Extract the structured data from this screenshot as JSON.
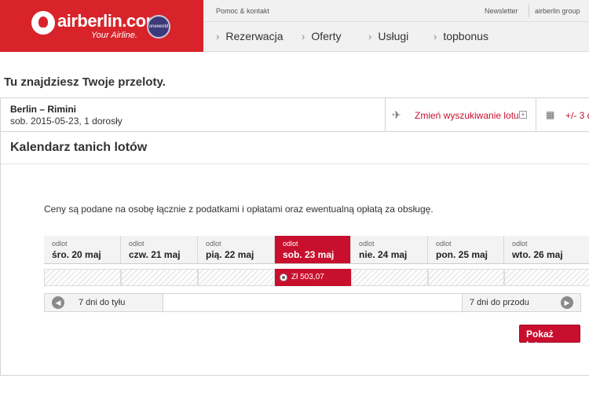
{
  "header": {
    "logo_text": "airberlin.com",
    "logo_tagline": "Your Airline.",
    "alliance_badge": "oneworld",
    "help_link": "Pomoc & kontakt",
    "newsletter_link": "Newsletter",
    "group_link": "airberlin group",
    "nav": [
      "Rezerwacja",
      "Oferty",
      "Usługi",
      "topbonus"
    ]
  },
  "page": {
    "title": "Tu znajdziesz Twoje przeloty."
  },
  "summary": {
    "route": "Berlin – Rimini",
    "details": "sob. 2015-05-23, 1 dorosły",
    "change_search": "Zmień wyszukiwanie lotu",
    "flex_days": "+/- 3 d"
  },
  "calendar": {
    "title": "Kalendarz tanich lotów",
    "info": "Ceny są podane na osobę łącznie z podatkami i opłatami oraz ewentualną opłatą za obsługę.",
    "days": [
      {
        "label": "odlot",
        "date": "śro. 20 maj"
      },
      {
        "label": "odlot",
        "date": "czw. 21 maj"
      },
      {
        "label": "odlot",
        "date": "pią. 22 maj"
      },
      {
        "label": "odlot",
        "date": "sob. 23 maj"
      },
      {
        "label": "odlot",
        "date": "nie. 24 maj"
      },
      {
        "label": "odlot",
        "date": "pon. 25 maj"
      },
      {
        "label": "odlot",
        "date": "wto. 26 maj"
      }
    ],
    "selected_price": "Zł 503,07",
    "prev_week": "7 dni do tyłu",
    "next_week": "7 dni do przodu",
    "show_flights": "Pokaż loty"
  },
  "icons": {
    "logo": "airberlin-logo-icon",
    "plane": "plane-icon",
    "expand": "plus-box-icon",
    "grid": "grid-icon",
    "prev": "arrow-left-circle-icon",
    "next": "arrow-right-circle-icon"
  },
  "colors": {
    "brand_red": "#d8232a",
    "accent_red": "#c8102e"
  }
}
